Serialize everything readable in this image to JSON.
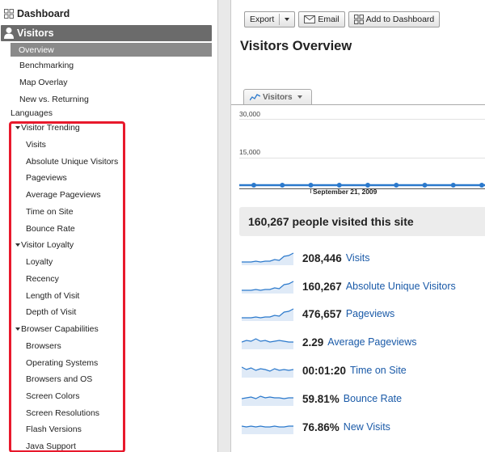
{
  "sidebar": {
    "dashboard_label": "Dashboard",
    "visitors_label": "Visitors",
    "overview_label": "Overview",
    "sub_items": [
      "Benchmarking",
      "Map Overlay",
      "New vs. Returning"
    ],
    "languages_label": "Languages",
    "groups": [
      {
        "label": "Visitor Trending",
        "items": [
          "Visits",
          "Absolute Unique Visitors",
          "Pageviews",
          "Average Pageviews",
          "Time on Site",
          "Bounce Rate"
        ]
      },
      {
        "label": "Visitor Loyalty",
        "items": [
          "Loyalty",
          "Recency",
          "Length of Visit",
          "Depth of Visit"
        ]
      },
      {
        "label": "Browser Capabilities",
        "items": [
          "Browsers",
          "Operating Systems",
          "Browsers and OS",
          "Screen Colors",
          "Screen Resolutions",
          "Flash Versions",
          "Java Support"
        ]
      }
    ],
    "highlight_color": "#e8192c"
  },
  "toolbar": {
    "export_label": "Export",
    "email_label": "Email",
    "add_dashboard_label": "Add to Dashboard"
  },
  "main": {
    "title": "Visitors Overview",
    "metric_selector": "Visitors",
    "summary": "160,267 people visited this site",
    "stats": [
      {
        "value": "208,446",
        "label": "Visits"
      },
      {
        "value": "160,267",
        "label": "Absolute Unique Visitors"
      },
      {
        "value": "476,657",
        "label": "Pageviews"
      },
      {
        "value": "2.29",
        "label": "Average Pageviews"
      },
      {
        "value": "00:01:20",
        "label": "Time on Site"
      },
      {
        "value": "59.81%",
        "label": "Bounce Rate"
      },
      {
        "value": "76.86%",
        "label": "New Visits"
      }
    ]
  },
  "chart_data": {
    "type": "line",
    "ylim": [
      0,
      30000
    ],
    "y_ticks": [
      "30,000",
      "15,000"
    ],
    "x_label_shown": "September 21, 2009",
    "series_color": "#2b79cc",
    "points": 9
  },
  "colors": {
    "link": "#1a5aa8",
    "sidebar_active": "#6b6b6b",
    "sidebar_subactive": "#8a8a8a"
  }
}
